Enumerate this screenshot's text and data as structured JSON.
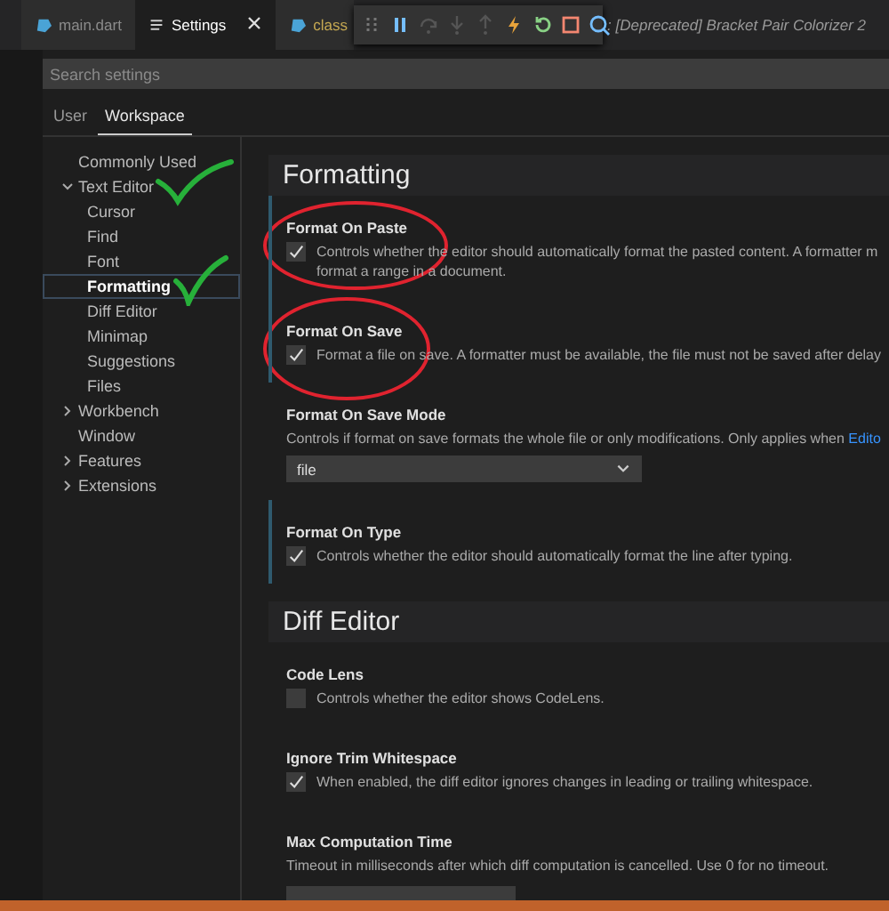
{
  "tabs": [
    {
      "label": "main.dart",
      "selected": false,
      "kind": "dart"
    },
    {
      "label": "Settings",
      "selected": true,
      "kind": "settings"
    },
    {
      "label": "class",
      "selected": false,
      "kind": "dart"
    }
  ],
  "tab_overflow_title": ": [Deprecated] Bracket Pair Colorizer 2",
  "search": {
    "placeholder": "Search settings"
  },
  "scope_tabs": [
    {
      "label": "User",
      "selected": false
    },
    {
      "label": "Workspace",
      "selected": true
    }
  ],
  "tree": [
    {
      "label": "Commonly Used",
      "selected": false
    },
    {
      "label": "Text Editor",
      "selected": false,
      "expanded": true,
      "children": [
        {
          "label": "Cursor",
          "selected": false
        },
        {
          "label": "Find",
          "selected": false
        },
        {
          "label": "Font",
          "selected": false
        },
        {
          "label": "Formatting",
          "selected": true
        },
        {
          "label": "Diff Editor",
          "selected": false
        },
        {
          "label": "Minimap",
          "selected": false
        },
        {
          "label": "Suggestions",
          "selected": false
        },
        {
          "label": "Files",
          "selected": false
        }
      ]
    },
    {
      "label": "Workbench",
      "selected": false,
      "expanded": false
    },
    {
      "label": "Window",
      "selected": false
    },
    {
      "label": "Features",
      "selected": false,
      "expanded": false
    },
    {
      "label": "Extensions",
      "selected": false,
      "expanded": false
    }
  ],
  "sections": [
    {
      "title": "Formatting",
      "settings": [
        {
          "kind": "checkbox",
          "title": "Format On Paste",
          "modified": true,
          "checked": true,
          "description": [
            "Controls whether the editor should automatically format the pasted content. A formatter m",
            "format a range in a document."
          ]
        },
        {
          "kind": "checkbox",
          "title": "Format On Save",
          "modified": true,
          "checked": true,
          "description": [
            "Format a file on save. A formatter must be available, the file must not be saved after delay"
          ]
        },
        {
          "kind": "select",
          "title": "Format On Save Mode",
          "modified": false,
          "description": [
            "Controls if format on save formats the whole file or only modifications. Only applies when"
          ],
          "link": "Edito",
          "value": "file"
        },
        {
          "kind": "checkbox",
          "title": "Format On Type",
          "modified": true,
          "checked": true,
          "description": [
            "Controls whether the editor should automatically format the line after typing."
          ]
        }
      ]
    },
    {
      "title": "Diff Editor",
      "settings": [
        {
          "kind": "checkbox",
          "title": "Code Lens",
          "modified": false,
          "checked": false,
          "description": [
            "Controls whether the editor shows CodeLens."
          ]
        },
        {
          "kind": "checkbox",
          "title": "Ignore Trim Whitespace",
          "modified": false,
          "checked": true,
          "description": [
            "When enabled, the diff editor ignores changes in leading or trailing whitespace."
          ]
        },
        {
          "kind": "number",
          "title": "Max Computation Time",
          "modified": false,
          "description": [
            "Timeout in milliseconds after which diff computation is cancelled. Use 0 for no timeout."
          ]
        }
      ]
    }
  ]
}
